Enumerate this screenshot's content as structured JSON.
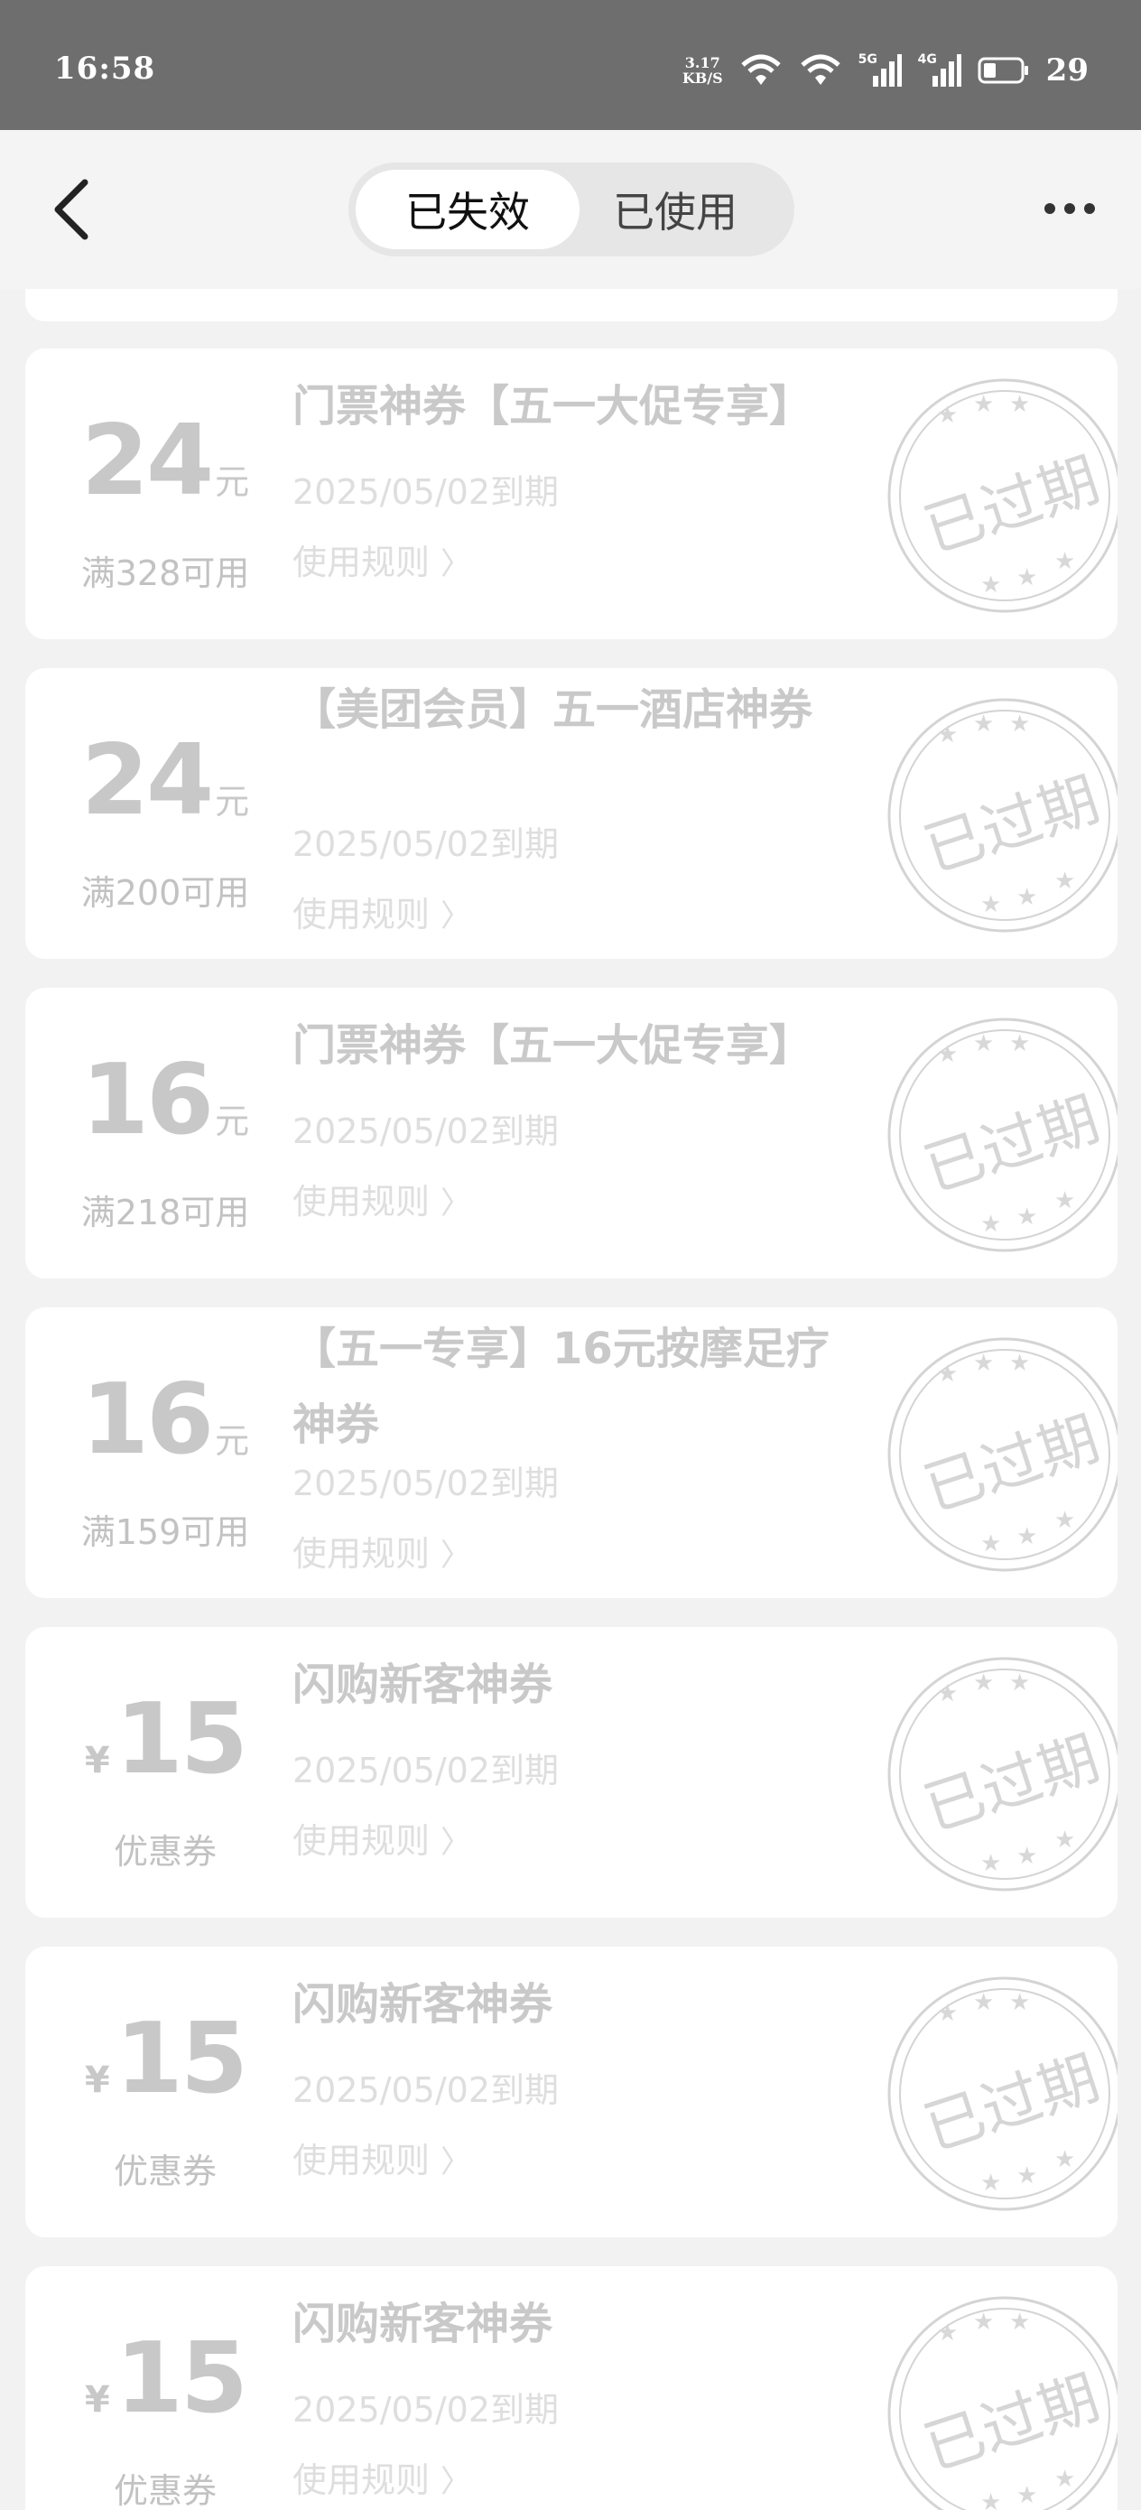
{
  "status_bar": {
    "time": "16:58",
    "net_speed_value": "3.17",
    "net_speed_unit": "KB/S",
    "sim1_label": "5G",
    "sim2_label": "4G",
    "battery_percent": "29"
  },
  "header": {
    "tabs": [
      {
        "label": "已失效",
        "active": true
      },
      {
        "label": "已使用",
        "active": false
      }
    ]
  },
  "coupons": [
    {
      "amount": "24",
      "currency_prefix": "",
      "unit": "元",
      "condition": "满328可用",
      "title": "门票神券【五一大促专享】",
      "expiry": "2025/05/02到期",
      "rules_label": "使用规则",
      "stamp_text": "已过期"
    },
    {
      "amount": "24",
      "currency_prefix": "",
      "unit": "元",
      "condition": "满200可用",
      "title": "【美团会员】五一酒店神券",
      "expiry": "2025/05/02到期",
      "rules_label": "使用规则",
      "stamp_text": "已过期"
    },
    {
      "amount": "16",
      "currency_prefix": "",
      "unit": "元",
      "condition": "满218可用",
      "title": "门票神券【五一大促专享】",
      "expiry": "2025/05/02到期",
      "rules_label": "使用规则",
      "stamp_text": "已过期"
    },
    {
      "amount": "16",
      "currency_prefix": "",
      "unit": "元",
      "condition": "满159可用",
      "title": "【五一专享】16元按摩足疗神券",
      "expiry": "2025/05/02到期",
      "rules_label": "使用规则",
      "stamp_text": "已过期"
    },
    {
      "amount": "15",
      "currency_prefix": "¥",
      "unit": "",
      "condition": "优惠券",
      "title": "闪购新客神券",
      "expiry": "2025/05/02到期",
      "rules_label": "使用规则",
      "stamp_text": "已过期"
    },
    {
      "amount": "15",
      "currency_prefix": "¥",
      "unit": "",
      "condition": "优惠券",
      "title": "闪购新客神券",
      "expiry": "2025/05/02到期",
      "rules_label": "使用规则",
      "stamp_text": "已过期"
    },
    {
      "amount": "15",
      "currency_prefix": "¥",
      "unit": "",
      "condition": "优惠券",
      "title": "闪购新客神券",
      "expiry": "2025/05/02到期",
      "rules_label": "使用规则",
      "stamp_text": "已过期"
    }
  ],
  "colors": {
    "status_bar_bg": "#6e6e6e",
    "page_bg": "#f2f2f2",
    "card_bg": "#ffffff",
    "expired_text": "#c8c8c8",
    "stamp_color": "#d4d4d4"
  },
  "icons": {
    "back": "chevron-left-icon",
    "more": "more-dots-icon",
    "wifi": "wifi-icon",
    "signal": "cell-signal-icon",
    "battery": "battery-icon",
    "stamp": "expired-stamp-icon"
  }
}
